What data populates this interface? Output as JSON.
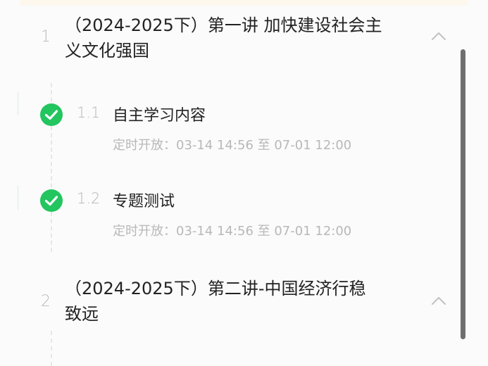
{
  "chapters": [
    {
      "number": "1",
      "title_line1": "（2024-2025下）第一讲 加快建设社会主",
      "title_line2": "义文化强国",
      "expanded": true,
      "chevron_icon": "chevron-up-icon",
      "sections": [
        {
          "number": "1.1",
          "title": "自主学习内容",
          "schedule": "定时开放：03-14 14:56 至 07-01 12:00",
          "status_icon": "check-circle-icon",
          "status_color": "#22c55e"
        },
        {
          "number": "1.2",
          "title": "专题测试",
          "schedule": "定时开放：03-14 14:56 至 07-01 12:00",
          "status_icon": "check-circle-icon",
          "status_color": "#22c55e"
        }
      ]
    },
    {
      "number": "2",
      "title_line1": "（2024-2025下）第二讲-中国经济行稳",
      "title_line2": "致远",
      "expanded": true,
      "chevron_icon": "chevron-up-icon"
    }
  ],
  "colors": {
    "accent_green": "#22c55e",
    "title_text": "#222222",
    "muted_text": "#b8b8b8"
  }
}
